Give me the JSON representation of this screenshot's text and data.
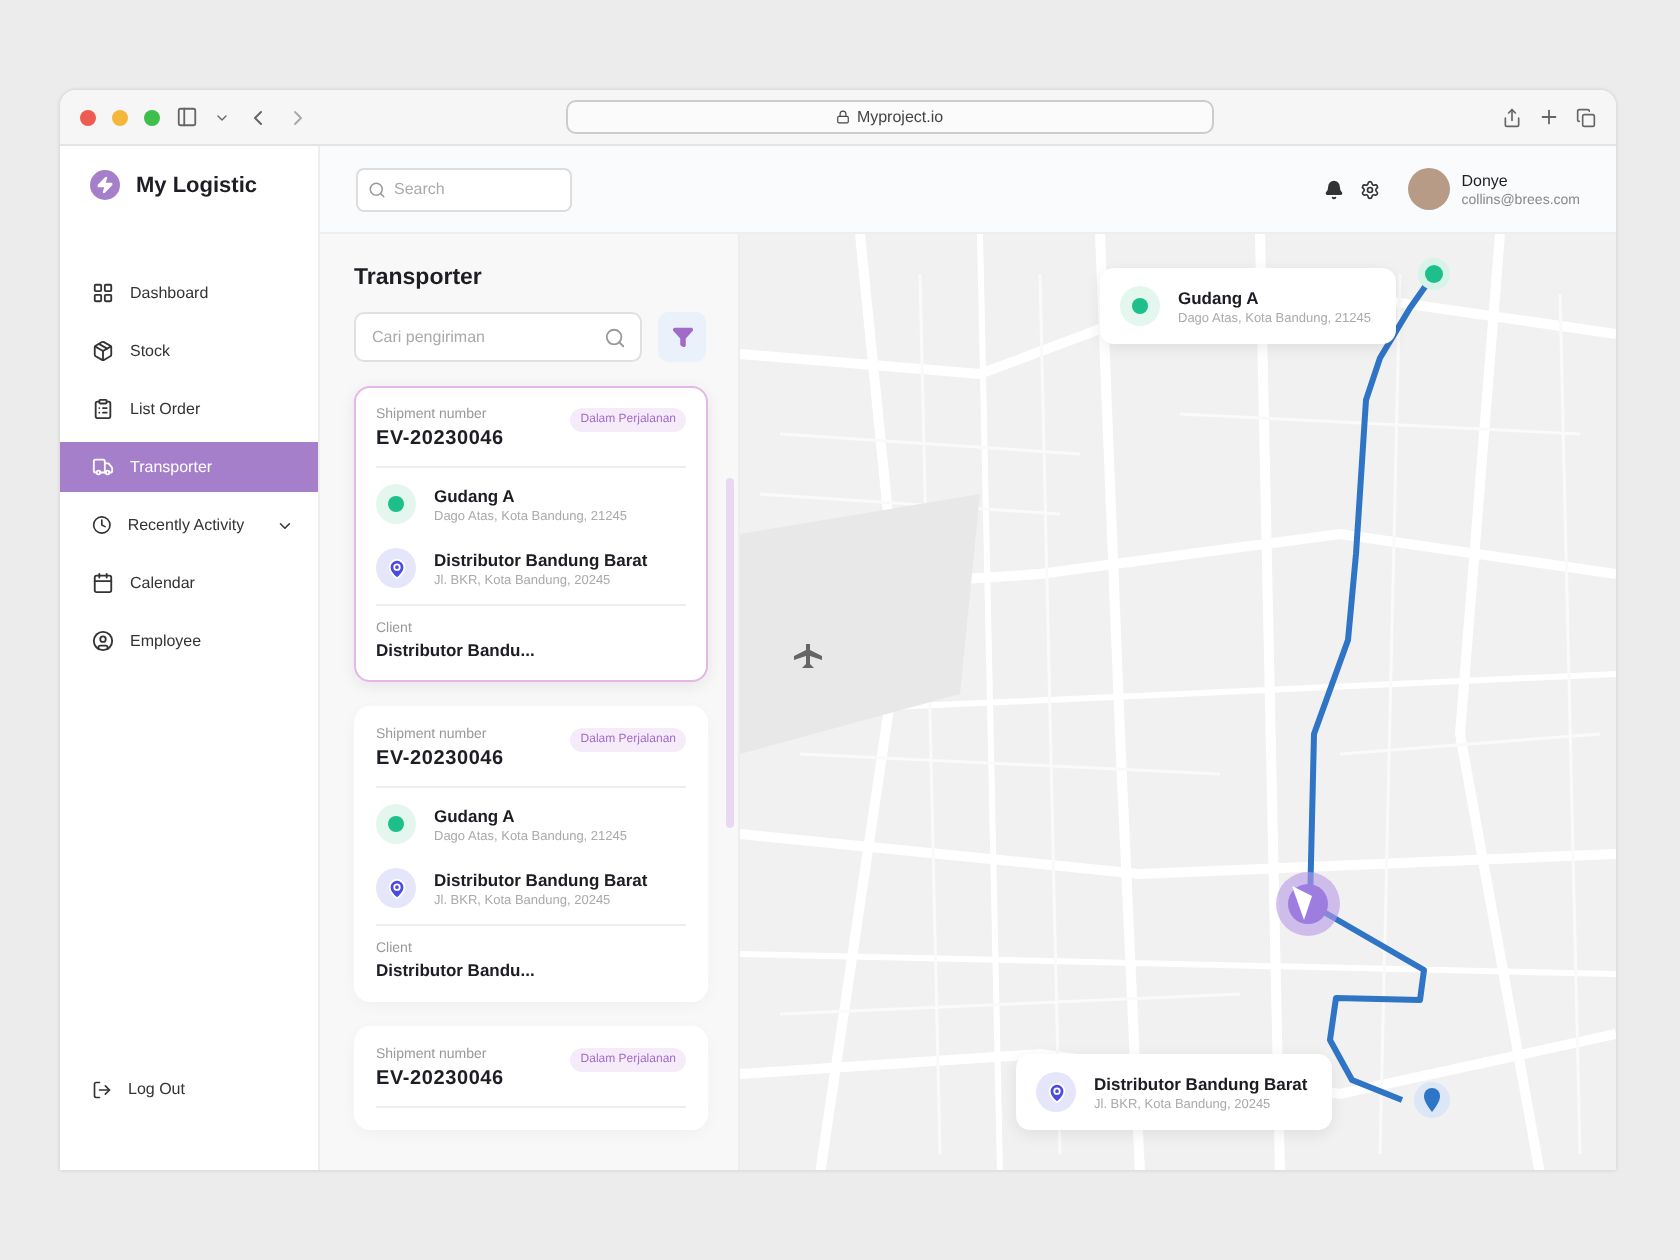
{
  "browser": {
    "url": "Myproject.io"
  },
  "sidebar": {
    "brand": "My Logistic",
    "items": [
      {
        "label": "Dashboard",
        "kind": "link",
        "selected": false
      },
      {
        "label": "Stock",
        "kind": "link",
        "selected": false
      },
      {
        "label": "List Order",
        "kind": "link",
        "selected": false
      },
      {
        "label": "Transporter",
        "kind": "link",
        "selected": true
      },
      {
        "label": "Recently Activity",
        "kind": "group",
        "selected": false
      },
      {
        "label": "Calendar",
        "kind": "link",
        "selected": false
      },
      {
        "label": "Employee",
        "kind": "link",
        "selected": false
      }
    ],
    "logout": "Log Out"
  },
  "header": {
    "search_placeholder": "Search",
    "user": {
      "name": "Donye",
      "email": "collins@brees.com"
    }
  },
  "panel": {
    "title": "Transporter",
    "search_placeholder": "Cari pengiriman",
    "shipments": [
      {
        "number_label": "Shipment number",
        "number": "EV-20230046",
        "status": "Dalam Perjalanan",
        "selected": true,
        "origin": {
          "name": "Gudang A",
          "address": "Dago Atas, Kota Bandung, 21245"
        },
        "destination": {
          "name": "Distributor Bandung Barat",
          "address": "Jl. BKR, Kota Bandung, 20245"
        },
        "client_label": "Client",
        "client": "Distributor Bandu..."
      },
      {
        "number_label": "Shipment number",
        "number": "EV-20230046",
        "status": "Dalam Perjalanan",
        "selected": false,
        "origin": {
          "name": "Gudang A",
          "address": "Dago Atas, Kota Bandung, 21245"
        },
        "destination": {
          "name": "Distributor Bandung Barat",
          "address": "Jl. BKR, Kota Bandung, 20245"
        },
        "client_label": "Client",
        "client": "Distributor Bandu..."
      },
      {
        "number_label": "Shipment number",
        "number": "EV-20230046",
        "status": "Dalam Perjalanan",
        "selected": false
      }
    ]
  },
  "map": {
    "origin_card": {
      "name": "Gudang A",
      "address": "Dago Atas, Kota Bandung, 21245"
    },
    "destination_card": {
      "name": "Distributor Bandung Barat",
      "address": "Jl. BKR, Kota Bandung, 20245"
    }
  }
}
